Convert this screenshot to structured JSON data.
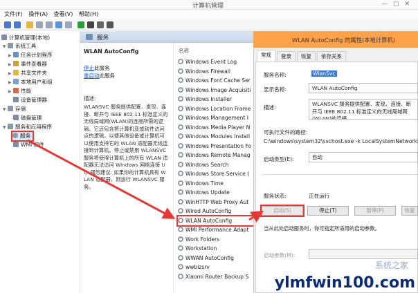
{
  "window": {
    "title": "计算机管理"
  },
  "menu": [
    "文件(F)",
    "操作(A)",
    "查看(V)",
    "帮助(H)"
  ],
  "tree": [
    {
      "label": "计算机管理(本地)",
      "level": 0
    },
    {
      "label": "系统工具",
      "level": 1
    },
    {
      "label": "任务计划程序",
      "level": 2
    },
    {
      "label": "事件查看器",
      "level": 2
    },
    {
      "label": "共享文件夹",
      "level": 2
    },
    {
      "label": "本地用户和组",
      "level": 2
    },
    {
      "label": "性能",
      "level": 2
    },
    {
      "label": "设备管理器",
      "level": 2
    },
    {
      "label": "存储",
      "level": 1
    },
    {
      "label": "磁盘管理",
      "level": 2
    },
    {
      "label": "服务和应用程序",
      "level": 1
    },
    {
      "label": "服务",
      "level": 2,
      "selected": true
    },
    {
      "label": "WMI 控件",
      "level": 2
    }
  ],
  "services": {
    "header": "服务",
    "selected_name": "WLAN AutoConfig",
    "stop_link": "停止",
    "stop_suffix": "此服务",
    "restart_link": "重启动",
    "restart_suffix": "此服务",
    "desc_label": "描述:",
    "description": "WLANSVC 服务提供配置、发现、连接、断开与 IEEE 802.11 标准定义的无线局域网(WLAN)的连接所需的逻辑。它还包含将计算机变成软件访问点的逻辑，以便其他设备或计算机可以使用支持它的 WLAN 适配器无线连接到计算机。停止或禁用 WLANSVC 服务将使得计算机上的所有 WLAN 适配器无法访问 Windows 网络连接 UI。强烈建议: 如果你的计算机具有 WLAN 适配器，则运行 WLANSVC 服务。",
    "col_name": "名称",
    "list": [
      "Windows Event Log",
      "Windows Firewall",
      "Windows Font Cache Ser",
      "Windows Image Acquisiti",
      "Windows Installer",
      "Windows Location Frame",
      "Windows Management I",
      "Windows Media Player N",
      "Windows Modules Install",
      "Windows Presentation Fo",
      "Windows Remote Manag",
      "Windows Search",
      "Windows Store Service (",
      "Windows Time",
      "Windows Update",
      "WinHTTP Web Proxy Aut",
      "Wired AutoConfig",
      "WLAN AutoConfig",
      "WMI Performance Adapt",
      "Work Folders",
      "Workstation",
      "WWAN AutoConfig",
      "wwbizsrv",
      "Xiaomi Router Backup S"
    ],
    "highlight_index": 17
  },
  "dialog": {
    "title": "WLAN AutoConfig 的属性(本地计算机)",
    "tabs": [
      "常规",
      "登录",
      "恢复",
      "依存关系"
    ],
    "active_tab": 0,
    "service_name_label": "服务名称:",
    "service_name": "WlanSvc",
    "display_name_label": "显示名称:",
    "display_name": "WLAN AutoConfig",
    "desc_label": "描述:",
    "desc": "WLANSVC 服务提供配置、发现、连接、断开与 IEEE 802.11 标准定义的无线局域网(WLAN)的连接",
    "path_label": "可执行文件的路径:",
    "path": "C:\\windows\\system32\\svchost.exe -k LocalSystemNetworkRe",
    "startup_label": "启动类型(E):",
    "startup": "自动",
    "status_label": "服务状态:",
    "status": "正在运行",
    "buttons": [
      "启动(S)",
      "停止(T)",
      "暂停(P)",
      "恢复(R)"
    ],
    "hint": "当从此处启动服务时，你可指定所适用的启动参数。",
    "params_label": "启动参数(M):"
  },
  "watermark": {
    "main": "ylmfwin100.com",
    "sub": "系统之家"
  },
  "colors": {
    "accent_red": "#e53935",
    "dialog_title": "#ffa24a"
  }
}
